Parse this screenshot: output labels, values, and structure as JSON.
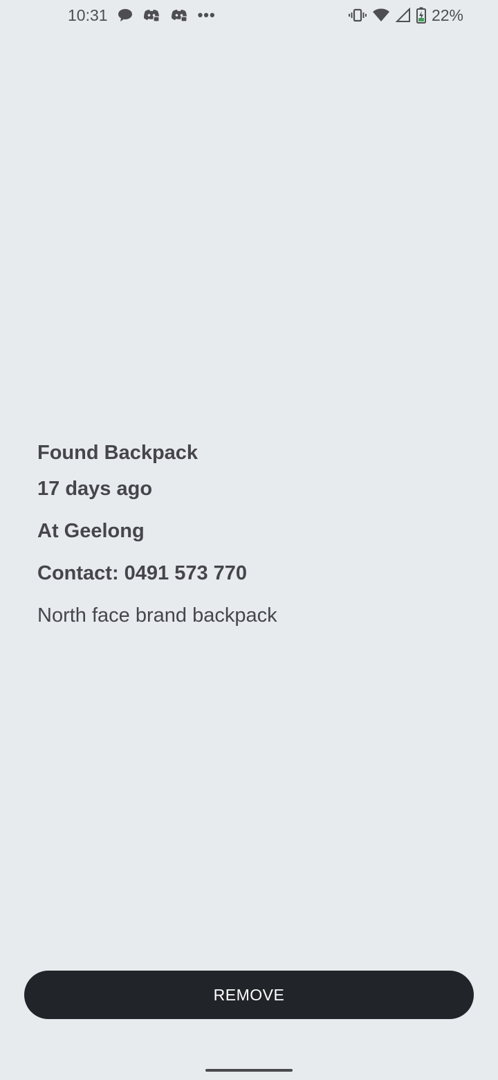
{
  "status_bar": {
    "time": "10:31",
    "notification_icons": [
      "chat-bubble-icon",
      "discord-icon",
      "discord-icon"
    ],
    "overflow": "•••",
    "system_icons": [
      "vibrate-icon",
      "wifi-icon",
      "signal-icon",
      "battery-charging-icon"
    ],
    "battery_percent": "22%"
  },
  "item": {
    "title": "Found Backpack",
    "time_ago": "17 days ago",
    "location": "At Geelong",
    "contact": "Contact: 0491 573 770",
    "description": "North face brand backpack"
  },
  "actions": {
    "remove_label": "REMOVE"
  },
  "colors": {
    "background": "#e7ebee",
    "text": "#46454b",
    "button_bg": "#212428",
    "button_text": "#ffffff",
    "battery_charge": "#3aa655"
  }
}
